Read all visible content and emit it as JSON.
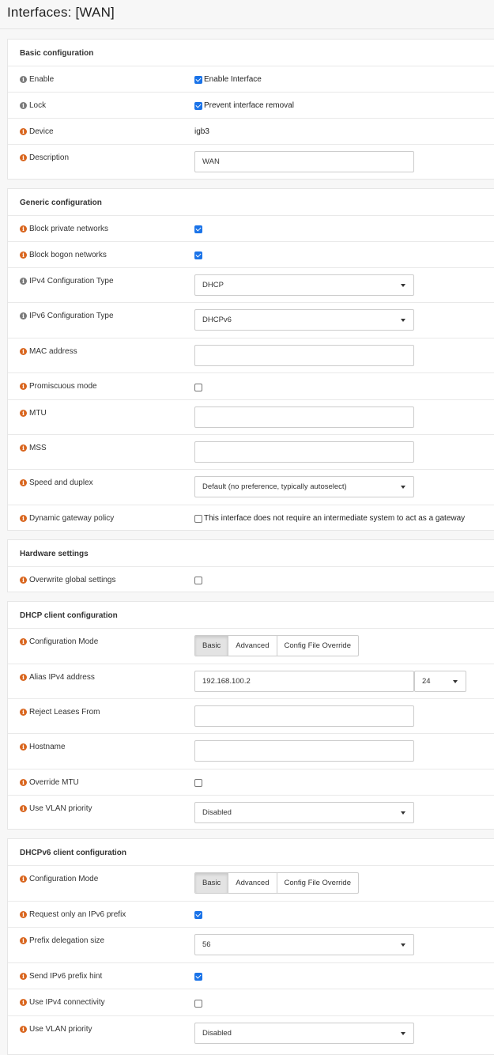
{
  "page": {
    "title": "Interfaces: [WAN]"
  },
  "basic": {
    "title": "Basic configuration",
    "enable_label": "Enable",
    "enable_checkbox_label": "Enable Interface",
    "lock_label": "Lock",
    "lock_checkbox_label": "Prevent interface removal",
    "device_label": "Device",
    "device_value": "igb3",
    "description_label": "Description",
    "description_value": "WAN"
  },
  "generic": {
    "title": "Generic configuration",
    "block_private_label": "Block private networks",
    "block_bogon_label": "Block bogon networks",
    "ipv4_type_label": "IPv4 Configuration Type",
    "ipv4_type_value": "DHCP",
    "ipv6_type_label": "IPv6 Configuration Type",
    "ipv6_type_value": "DHCPv6",
    "mac_label": "MAC address",
    "mac_value": "",
    "promisc_label": "Promiscuous mode",
    "mtu_label": "MTU",
    "mtu_value": "",
    "mss_label": "MSS",
    "mss_value": "",
    "speed_label": "Speed and duplex",
    "speed_value": "Default (no preference, typically autoselect)",
    "dyn_gw_label": "Dynamic gateway policy",
    "dyn_gw_checkbox_label": "This interface does not require an intermediate system to act as a gateway"
  },
  "hardware": {
    "title": "Hardware settings",
    "overwrite_label": "Overwrite global settings"
  },
  "dhcp": {
    "title": "DHCP client configuration",
    "mode_label": "Configuration Mode",
    "mode_options": [
      "Basic",
      "Advanced",
      "Config File Override"
    ],
    "alias_label": "Alias IPv4 address",
    "alias_value": "192.168.100.2",
    "alias_prefix": "24",
    "reject_label": "Reject Leases From",
    "reject_value": "",
    "hostname_label": "Hostname",
    "hostname_value": "",
    "override_mtu_label": "Override MTU",
    "vlan_label": "Use VLAN priority",
    "vlan_value": "Disabled"
  },
  "dhcp6": {
    "title": "DHCPv6 client configuration",
    "mode_label": "Configuration Mode",
    "mode_options": [
      "Basic",
      "Advanced",
      "Config File Override"
    ],
    "req_prefix_label": "Request only an IPv6 prefix",
    "pd_size_label": "Prefix delegation size",
    "pd_size_value": "56",
    "send_hint_label": "Send IPv6 prefix hint",
    "use_ipv4_label": "Use IPv4 connectivity",
    "vlan_label": "Use VLAN priority",
    "vlan_value": "Disabled"
  },
  "colors": {
    "checkbox": "#1a73e8",
    "info_orange": "#d9661f",
    "info_grey": "#7a7a7a"
  },
  "checkbox_states": {
    "enable": true,
    "lock": true,
    "block_private": true,
    "block_bogon": true,
    "promisc": false,
    "dyn_gw": false,
    "overwrite": false,
    "override_mtu": false,
    "req_prefix": true,
    "send_hint": true,
    "use_ipv4": false
  }
}
